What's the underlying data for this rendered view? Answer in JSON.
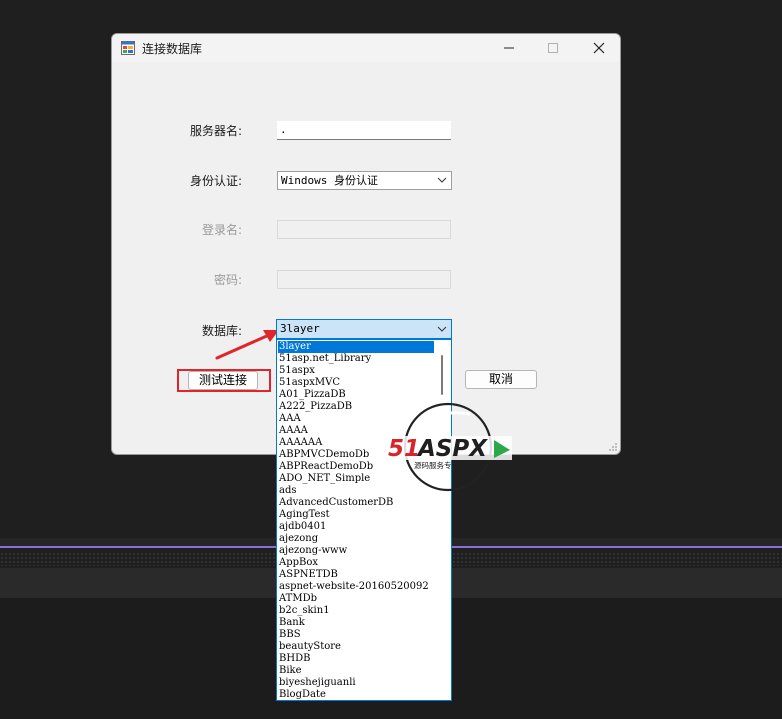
{
  "window": {
    "title": "连接数据库"
  },
  "form": {
    "server_label": "服务器名:",
    "server_value": ".",
    "auth_label": "身份认证:",
    "auth_value": "Windows 身份认证",
    "login_label": "登录名:",
    "login_value": "",
    "password_label": "密码:",
    "password_value": "",
    "database_label": "数据库:",
    "database_value": "3layer"
  },
  "buttons": {
    "test_label": "测试连接",
    "cancel_label": "取消"
  },
  "database_options": [
    "3layer",
    "51asp.net_Library",
    "51aspx",
    "51aspxMVC",
    "A01_PizzaDB",
    "A222_PizzaDB",
    "AAA",
    "AAAA",
    "AAAAAA",
    "ABPMVCDemoDb",
    "ABPReactDemoDb",
    "ADO_NET_Simple",
    "ads",
    "AdvancedCustomerDB",
    "AgingTest",
    "ajdb0401",
    "ajezong",
    "ajezong-www",
    "AppBox",
    "ASPNETDB",
    "aspnet-website-20160520092",
    "ATMDb",
    "b2c_skin1",
    "Bank",
    "BBS",
    "beautyStore",
    "BHDB",
    "Bike",
    "biyeshejiguanli",
    "BlogDate"
  ],
  "selected_index": 0,
  "watermark": {
    "brand": "51ASPX",
    "tagline": "源码服务专家"
  },
  "colors": {
    "accent": "#0078d4",
    "selection": "#0078d7",
    "annotation_red": "#e0252b",
    "taskbar_purple": "#8a6fd6"
  }
}
